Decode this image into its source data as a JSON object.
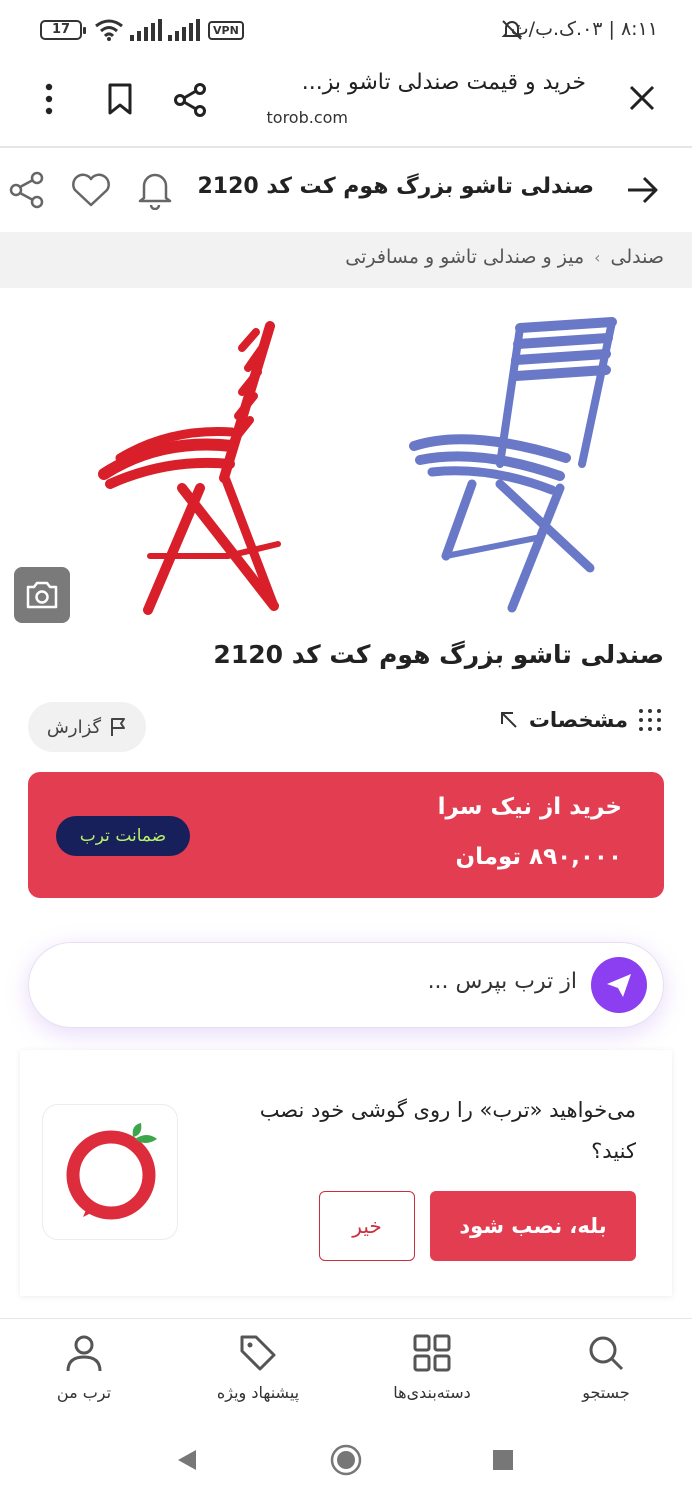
{
  "status_bar": {
    "time": "۸:۱۱ | ۰۳.ک.ب/ث",
    "battery": "17",
    "vpn": "VPN"
  },
  "browser": {
    "tab_title": "خرید و قیمت صندلی تاشو بز...",
    "url": "torob.com"
  },
  "header": {
    "title": "صندلی تاشو بزرگ هوم کت کد 2120"
  },
  "breadcrumb": {
    "items": [
      "صندلی",
      "میز و صندلی تاشو و مسافرتی"
    ]
  },
  "product": {
    "title": "صندلی تاشو بزرگ هوم کت کد 2120",
    "specs_label": "مشخصات",
    "report_label": "گزارش"
  },
  "buy_card": {
    "store": "خرید از نیک سرا",
    "price": "۸۹۰,۰۰۰ تومان",
    "guarantee": "ضمانت ترب"
  },
  "ask": {
    "placeholder": "از ترب بپرس ..."
  },
  "install_prompt": {
    "text": "می‌خواهید «ترب» را روی گوشی خود نصب کنید؟",
    "yes_label": "بله، نصب شود",
    "no_label": "خیر"
  },
  "bottom_nav": {
    "items": [
      {
        "label": "جستجو",
        "icon": "search-icon"
      },
      {
        "label": "دسته‌بندی‌ها",
        "icon": "categories-icon"
      },
      {
        "label": "پیشنهاد ویژه",
        "icon": "tag-icon"
      },
      {
        "label": "ترب من",
        "icon": "user-icon"
      }
    ]
  },
  "colors": {
    "accent_red": "#e33d52",
    "ask_purple": "#8b3ff0",
    "badge_navy": "#17205a",
    "badge_text": "#b8f06a"
  }
}
